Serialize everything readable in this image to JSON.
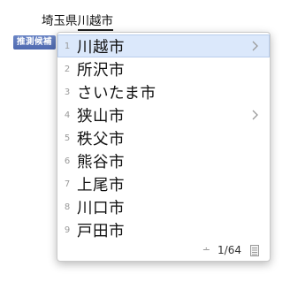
{
  "composition": {
    "prefix": "埼玉県",
    "active": "川越市"
  },
  "mode_badge": "推測候補",
  "candidates": [
    {
      "number": "1",
      "text": "川越市",
      "has_submenu": true,
      "selected": true
    },
    {
      "number": "2",
      "text": "所沢市",
      "has_submenu": false,
      "selected": false
    },
    {
      "number": "3",
      "text": "さいたま市",
      "has_submenu": false,
      "selected": false
    },
    {
      "number": "4",
      "text": "狭山市",
      "has_submenu": true,
      "selected": false
    },
    {
      "number": "5",
      "text": "秩父市",
      "has_submenu": false,
      "selected": false
    },
    {
      "number": "6",
      "text": "熊谷市",
      "has_submenu": false,
      "selected": false
    },
    {
      "number": "7",
      "text": "上尾市",
      "has_submenu": false,
      "selected": false
    },
    {
      "number": "8",
      "text": "川口市",
      "has_submenu": false,
      "selected": false
    },
    {
      "number": "9",
      "text": "戸田市",
      "has_submenu": false,
      "selected": false
    }
  ],
  "footer": {
    "plusminus_symbol": "∸",
    "page_count": "1/64"
  },
  "colors": {
    "selection_background": "#dbe8fb",
    "badge_background": "#5a74b8"
  }
}
